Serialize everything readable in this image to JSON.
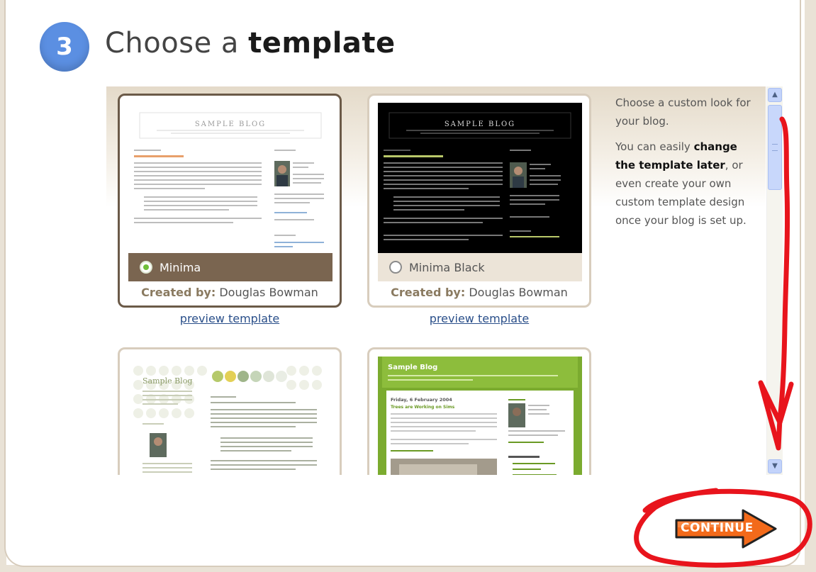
{
  "step": {
    "number": "3",
    "title_prefix": "Choose a",
    "title_bold": "template"
  },
  "templates": [
    {
      "name": "Minima",
      "created_by_label": "Created by:",
      "author": "Douglas Bowman",
      "preview_label": "preview template",
      "selected": true,
      "thumb_title": "SAMPLE BLOG"
    },
    {
      "name": "Minima Black",
      "created_by_label": "Created by:",
      "author": "Douglas Bowman",
      "preview_label": "preview template",
      "selected": false,
      "thumb_title": "SAMPLE BLOG"
    },
    {
      "thumb_title": "Sample Blog"
    },
    {
      "thumb_title": "Sample Blog",
      "thumb_date": "Friday, 6 February 2004",
      "thumb_post": "Trees are Working on Sims"
    }
  ],
  "sidebar": {
    "p1": "Choose a custom look for your blog.",
    "p2_a": "You can easily",
    "p2_b": "change the template later",
    "p2_c": ", or even create your own custom template design once your blog is set up."
  },
  "continue_label": "CONTINUE",
  "colors": {
    "accent_blue": "#5b8fe2",
    "selected_bar": "#7a6550",
    "continue_orange": "#f36a1a",
    "annotation_red": "#e8141c"
  }
}
